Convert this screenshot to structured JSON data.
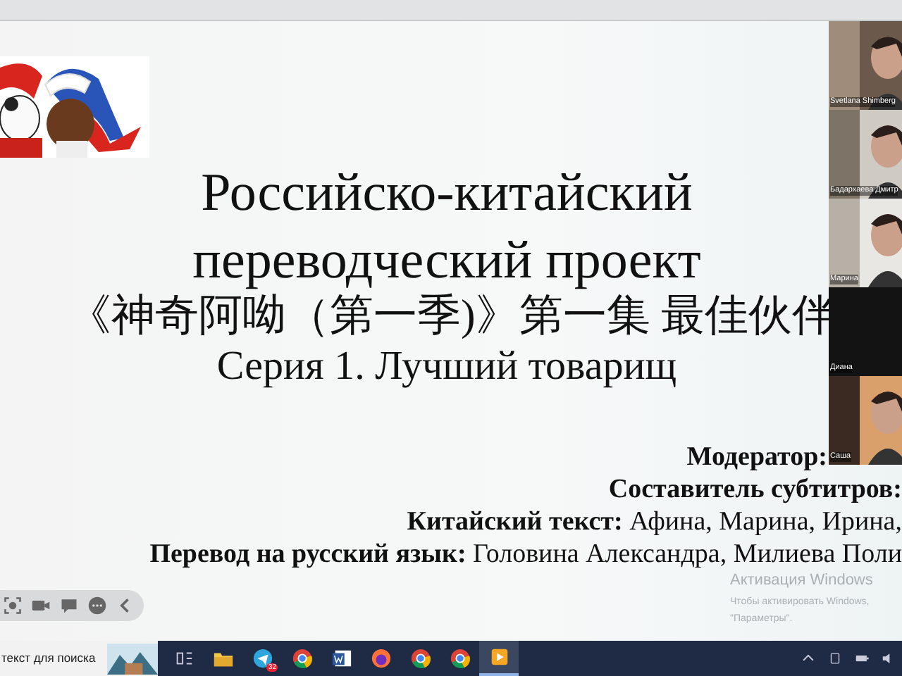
{
  "slide": {
    "title_lines": [
      "Российско-китайский",
      "переводческий проект"
    ],
    "chinese_title": "《神奇阿呦（第一季)》第一集 最佳伙伴",
    "subtitle": "Серия 1. Лучший товарищ",
    "credits": [
      {
        "label": "Модератор:"
      },
      {
        "label": "Составитель субтитров:"
      },
      {
        "label": "Китайский текст:",
        "value": "Афина, Марина, Ирина,"
      },
      {
        "label": "Перевод на русский язык:",
        "value": "Головина Александра, Милиева Поли"
      }
    ]
  },
  "video_tiles": [
    {
      "name": "Svetlana Shimberg",
      "video": true
    },
    {
      "name": "Бадархаева Дмитр",
      "video": true
    },
    {
      "name": "Марина",
      "video": true
    },
    {
      "name": "Диана",
      "video": false
    },
    {
      "name": "Саша",
      "video": true
    }
  ],
  "activation_notice": {
    "title": "Активация Windows",
    "lines": [
      "Чтобы активировать Windows,",
      "\"Параметры\"."
    ]
  },
  "taskbar": {
    "search_placeholder": "текст для поиска",
    "apps": [
      {
        "kind": "taskview",
        "active": false
      },
      {
        "kind": "folder",
        "active": false
      },
      {
        "kind": "telegram",
        "active": false,
        "badge": "32"
      },
      {
        "kind": "chrome",
        "active": false
      },
      {
        "kind": "word",
        "active": false
      },
      {
        "kind": "firefox",
        "active": false
      },
      {
        "kind": "chrome",
        "active": false
      },
      {
        "kind": "chrome",
        "active": false
      },
      {
        "kind": "player",
        "active": true
      }
    ]
  }
}
